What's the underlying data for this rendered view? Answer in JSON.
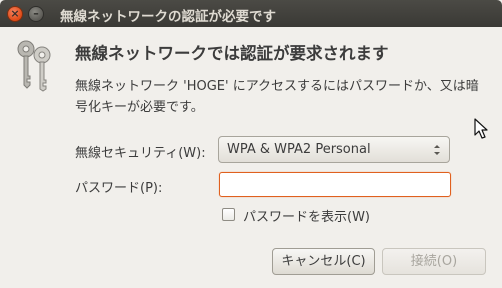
{
  "window": {
    "title": "無線ネットワークの認証が必要です",
    "close_glyph": "×",
    "minimize_glyph": "–"
  },
  "dialog": {
    "heading": "無線ネットワークでは認証が要求されます",
    "description": "無線ネットワーク 'HOGE' にアクセスするにはパスワードか、又は暗号化キーが必要です。",
    "icon": "keys-icon"
  },
  "form": {
    "security_label": "無線セキュリティ(W):",
    "security_value": "WPA & WPA2 Personal",
    "password_label": "パスワード(P):",
    "password_value": "",
    "show_password_label": "パスワードを表示(W)",
    "show_password_checked": false
  },
  "buttons": {
    "cancel": "キャンセル(C)",
    "connect": "接続(O)"
  },
  "colors": {
    "titlebar": "#3c3b37",
    "background": "#f1efeb",
    "focus_border": "#e0601e",
    "close_button": "#df4a16"
  }
}
